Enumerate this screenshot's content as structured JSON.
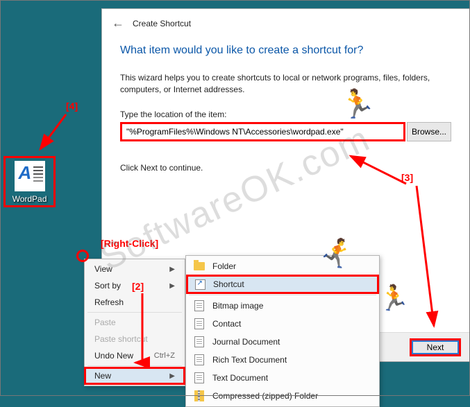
{
  "desktop_icon": {
    "label": "WordPad"
  },
  "wizard": {
    "title": "Create Shortcut",
    "heading": "What item would you like to create a shortcut for?",
    "description": "This wizard helps you to create shortcuts to local or network programs, files, folders, computers, or Internet addresses.",
    "location_label": "Type the location of the item:",
    "location_value": "\"%ProgramFiles%\\Windows NT\\Accessories\\wordpad.exe\"",
    "browse_label": "Browse...",
    "continue_text": "Click Next to continue.",
    "next_label": "Next"
  },
  "context_menu": {
    "view": "View",
    "sort_by": "Sort by",
    "refresh": "Refresh",
    "paste": "Paste",
    "paste_shortcut": "Paste shortcut",
    "undo_new": "Undo New",
    "undo_new_shortcut": "Ctrl+Z",
    "new": "New"
  },
  "submenu": {
    "folder": "Folder",
    "shortcut": "Shortcut",
    "bitmap": "Bitmap image",
    "contact": "Contact",
    "journal": "Journal Document",
    "rtf": "Rich Text Document",
    "text": "Text Document",
    "zip": "Compressed (zipped) Folder"
  },
  "annotations": {
    "a2": "[2]",
    "a3": "[3]",
    "a4": "[4]",
    "right_click": "[Right-Click]"
  },
  "watermark": "SoftwareOK.com"
}
